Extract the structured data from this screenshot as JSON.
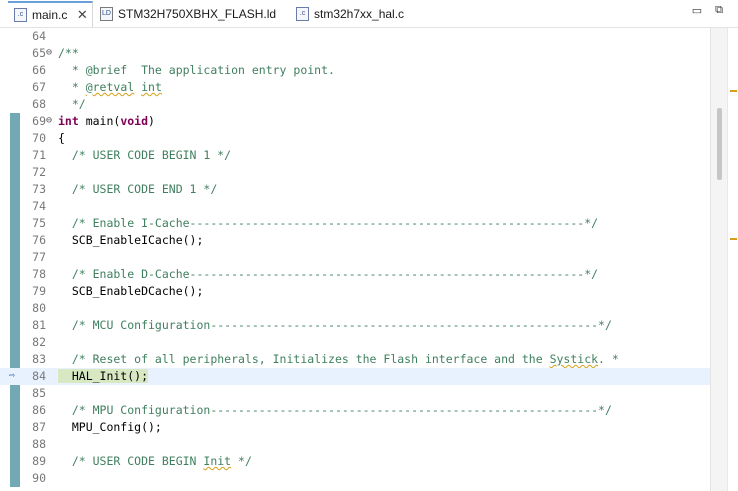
{
  "tabs": [
    {
      "label": "main.c",
      "icon": "c-source-file-icon",
      "icon_text": ".c",
      "active": true
    },
    {
      "label": "STM32H750XBHX_FLASH.ld",
      "icon": "linker-script-file-icon",
      "icon_text": "LD",
      "active": false
    },
    {
      "label": "stm32h7xx_hal.c",
      "icon": "c-source-file-icon",
      "icon_text": ".c",
      "active": false
    }
  ],
  "window_controls": {
    "minimize": "▭",
    "maximize": "⧉"
  },
  "close_glyph": "✕",
  "fold_glyph": "⊖",
  "current_line_marker": "⇨",
  "lines": [
    {
      "num": "64",
      "parts": []
    },
    {
      "num": "65",
      "fold": true,
      "parts": [
        {
          "t": "/**",
          "c": "comment"
        }
      ]
    },
    {
      "num": "66",
      "parts": [
        {
          "t": "  * @brief  The application entry point.",
          "c": "comment"
        }
      ]
    },
    {
      "num": "67",
      "parts": [
        {
          "t": "  * ",
          "c": "comment"
        },
        {
          "t": "@retval",
          "c": "comment squig"
        },
        {
          "t": " ",
          "c": "comment"
        },
        {
          "t": "int",
          "c": "comment squig"
        }
      ]
    },
    {
      "num": "68",
      "parts": [
        {
          "t": "  */",
          "c": "comment"
        }
      ]
    },
    {
      "num": "69",
      "fold": true,
      "parts": [
        {
          "t": "int",
          "c": "kw"
        },
        {
          "t": " main(",
          "c": ""
        },
        {
          "t": "void",
          "c": "kw"
        },
        {
          "t": ")",
          "c": ""
        }
      ]
    },
    {
      "num": "70",
      "parts": [
        {
          "t": "{",
          "c": ""
        }
      ]
    },
    {
      "num": "71",
      "parts": [
        {
          "t": "  /* USER CODE BEGIN 1 */",
          "c": "comment"
        }
      ]
    },
    {
      "num": "72",
      "parts": []
    },
    {
      "num": "73",
      "parts": [
        {
          "t": "  /* USER CODE END 1 */",
          "c": "comment"
        }
      ]
    },
    {
      "num": "74",
      "parts": []
    },
    {
      "num": "75",
      "parts": [
        {
          "t": "  /* Enable I-Cache---------------------------------------------------------*/",
          "c": "comment"
        }
      ]
    },
    {
      "num": "76",
      "parts": [
        {
          "t": "  SCB_EnableICache();",
          "c": ""
        }
      ]
    },
    {
      "num": "77",
      "parts": []
    },
    {
      "num": "78",
      "parts": [
        {
          "t": "  /* Enable D-Cache---------------------------------------------------------*/",
          "c": "comment"
        }
      ]
    },
    {
      "num": "79",
      "parts": [
        {
          "t": "  SCB_EnableDCache();",
          "c": ""
        }
      ]
    },
    {
      "num": "80",
      "parts": []
    },
    {
      "num": "81",
      "parts": [
        {
          "t": "  /* MCU Configuration--------------------------------------------------------*/",
          "c": "comment"
        }
      ]
    },
    {
      "num": "82",
      "parts": []
    },
    {
      "num": "83",
      "parts": [
        {
          "t": "  /* Reset of all peripherals, Initializes the Flash interface and the ",
          "c": "comment"
        },
        {
          "t": "Systick",
          "c": "comment squig"
        },
        {
          "t": ". *",
          "c": "comment"
        }
      ]
    },
    {
      "num": "84",
      "current": true,
      "parts": [
        {
          "t": "  HAL_Init();",
          "c": "markbox"
        }
      ]
    },
    {
      "num": "85",
      "parts": []
    },
    {
      "num": "86",
      "parts": [
        {
          "t": "  /* MPU Configuration--------------------------------------------------------*/",
          "c": "comment"
        }
      ]
    },
    {
      "num": "87",
      "parts": [
        {
          "t": "  MPU_Config();",
          "c": ""
        }
      ]
    },
    {
      "num": "88",
      "parts": []
    },
    {
      "num": "89",
      "parts": [
        {
          "t": "  /* USER CODE BEGIN ",
          "c": "comment"
        },
        {
          "t": "Init",
          "c": "comment squig"
        },
        {
          "t": " */",
          "c": "comment"
        }
      ]
    },
    {
      "num": "90",
      "parts": []
    }
  ]
}
